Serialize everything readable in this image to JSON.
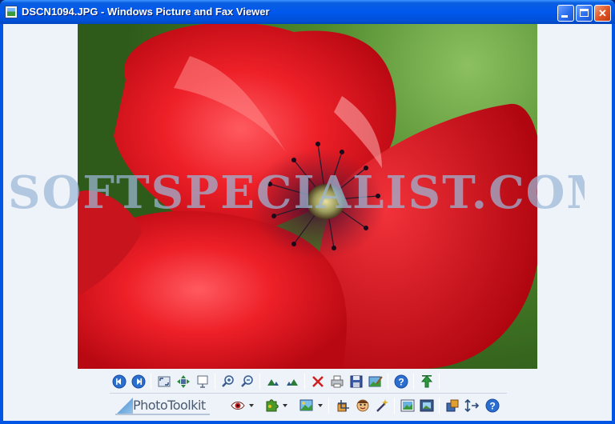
{
  "window": {
    "title": "DSCN1094.JPG - Windows Picture and Fax Viewer"
  },
  "watermark": "SOFTSPECIALIST.COM",
  "photo_toolkit": {
    "label": "PhotoToolkit"
  },
  "toolbar": {
    "row1": [
      "previous-image",
      "next-image",
      "best-fit",
      "actual-size",
      "slideshow",
      "zoom-in",
      "zoom-out",
      "rotate-clockwise",
      "rotate-counterclockwise",
      "delete",
      "print",
      "copy-to",
      "open-for-editing",
      "help",
      "exit"
    ],
    "row2": [
      "red-eye",
      "effects",
      "adjust",
      "crop",
      "face",
      "wand",
      "photo",
      "frame",
      "share",
      "resize",
      "help"
    ]
  },
  "colors": {
    "titlebar": "#0058ee",
    "client": "#eef3fa",
    "petal": "#e8202a"
  }
}
